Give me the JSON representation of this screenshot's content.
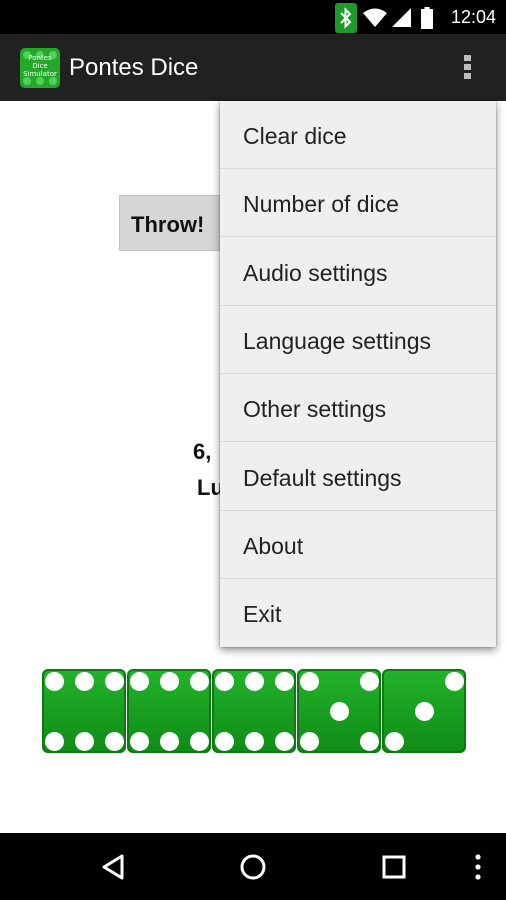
{
  "status_bar": {
    "time": "12:04",
    "icons": [
      "bluetooth-icon",
      "wifi-icon",
      "signal-icon",
      "battery-icon"
    ],
    "bluetooth_highlight_color": "#1f9a2a"
  },
  "action_bar": {
    "logo_text": [
      "Pontes",
      "Dice",
      "Simulator"
    ],
    "title": "Pontes Dice",
    "overflow_icon": "more-vert-icon"
  },
  "main": {
    "throw_label": "Throw!",
    "result_line1": "6,",
    "result_line2": "Lu"
  },
  "dice": [
    {
      "value": 6
    },
    {
      "value": 6
    },
    {
      "value": 6
    },
    {
      "value": 5
    },
    {
      "value": 3
    }
  ],
  "menu": {
    "items": [
      {
        "label": "Clear dice"
      },
      {
        "label": "Number of dice"
      },
      {
        "label": "Audio settings"
      },
      {
        "label": "Language settings"
      },
      {
        "label": "Other settings"
      },
      {
        "label": "Default settings"
      },
      {
        "label": "About"
      },
      {
        "label": "Exit"
      }
    ]
  },
  "nav_bar": {
    "icons": [
      "back-icon",
      "home-icon",
      "recents-icon",
      "more-vert-icon"
    ]
  },
  "colors": {
    "die_green": "#1aa822",
    "action_bar": "#212121",
    "menu_bg": "#efefef"
  }
}
